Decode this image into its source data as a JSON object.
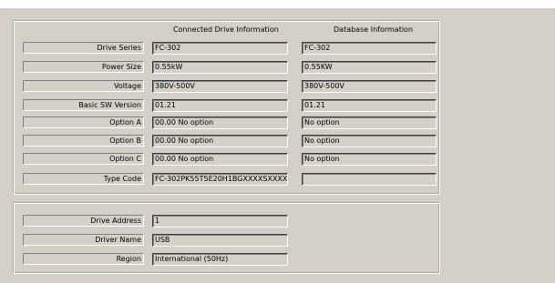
{
  "headers": {
    "connected": "Connected Drive Information",
    "database": "Database Information"
  },
  "drive_rows": [
    {
      "label": "Drive Series",
      "connected": "FC-302",
      "database": "FC-302"
    },
    {
      "label": "Power Size",
      "connected": "0.55kW",
      "database": "0.55KW"
    },
    {
      "label": "Voltage",
      "connected": "380V-500V",
      "database": "380V-500V"
    },
    {
      "label": "Basic SW Version",
      "connected": "01.21",
      "database": "01.21"
    },
    {
      "label": "Option A",
      "connected": "00.00 No option",
      "database": "No option"
    },
    {
      "label": "Option B",
      "connected": "00.00 No option",
      "database": "No option"
    },
    {
      "label": "Option C",
      "connected": "00.00 No option",
      "database": "No option"
    },
    {
      "label": "Type Code",
      "connected": "FC-302PK55T5E20H1BGXXXXSXXXXA",
      "database": ""
    }
  ],
  "connection_rows": [
    {
      "label": "Drive Address",
      "value": "1"
    },
    {
      "label": "Driver Name",
      "value": "USB"
    },
    {
      "label": "Region",
      "value": "International (50Hz)"
    }
  ]
}
